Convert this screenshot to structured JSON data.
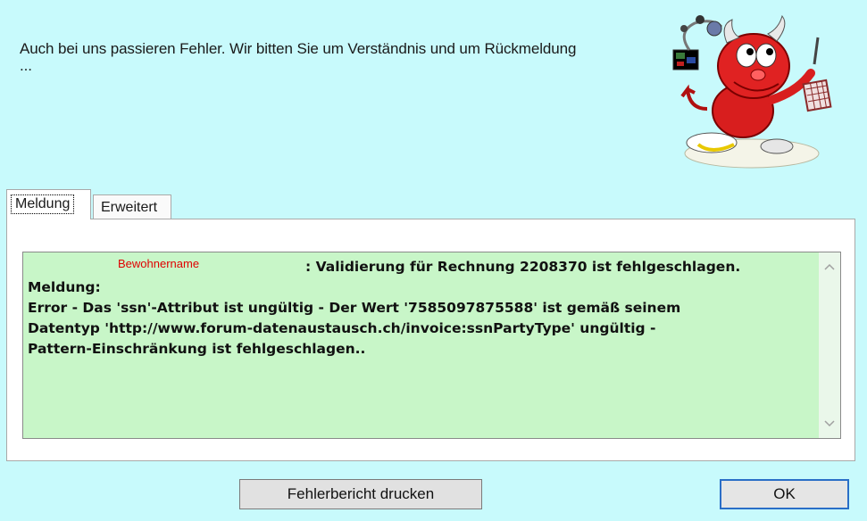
{
  "header": {
    "message": "Auch bei uns passieren Fehler. Wir bitten Sie um Verständnis und um Rückmeldung",
    "ellipsis": "..."
  },
  "tabs": [
    {
      "label": "Meldung",
      "active": true
    },
    {
      "label": "Erweitert",
      "active": false
    }
  ],
  "message_box": {
    "resident_placeholder": "Bewohnername",
    "lines": [
      ": Validierung für Rechnung 2208370 ist fehlgeschlagen.",
      "Meldung:",
      "Error - Das 'ssn'-Attribut ist ungültig - Der Wert '7585097875588' ist gemäß seinem",
      "Datentyp 'http://www.forum-datenaustausch.ch/invoice:ssnPartyType' ungültig -",
      "Pattern-Einschränkung ist fehlgeschlagen.."
    ],
    "background": "#c8f6c8"
  },
  "buttons": {
    "print_label": "Fehlerbericht drucken",
    "ok_label": "OK"
  },
  "colors": {
    "window_bg": "#c8fafc",
    "resident_text": "#e00000",
    "ok_border": "#2a6ec7"
  },
  "icons": {
    "mascot": "bsd-daemon-debugging-icon"
  }
}
